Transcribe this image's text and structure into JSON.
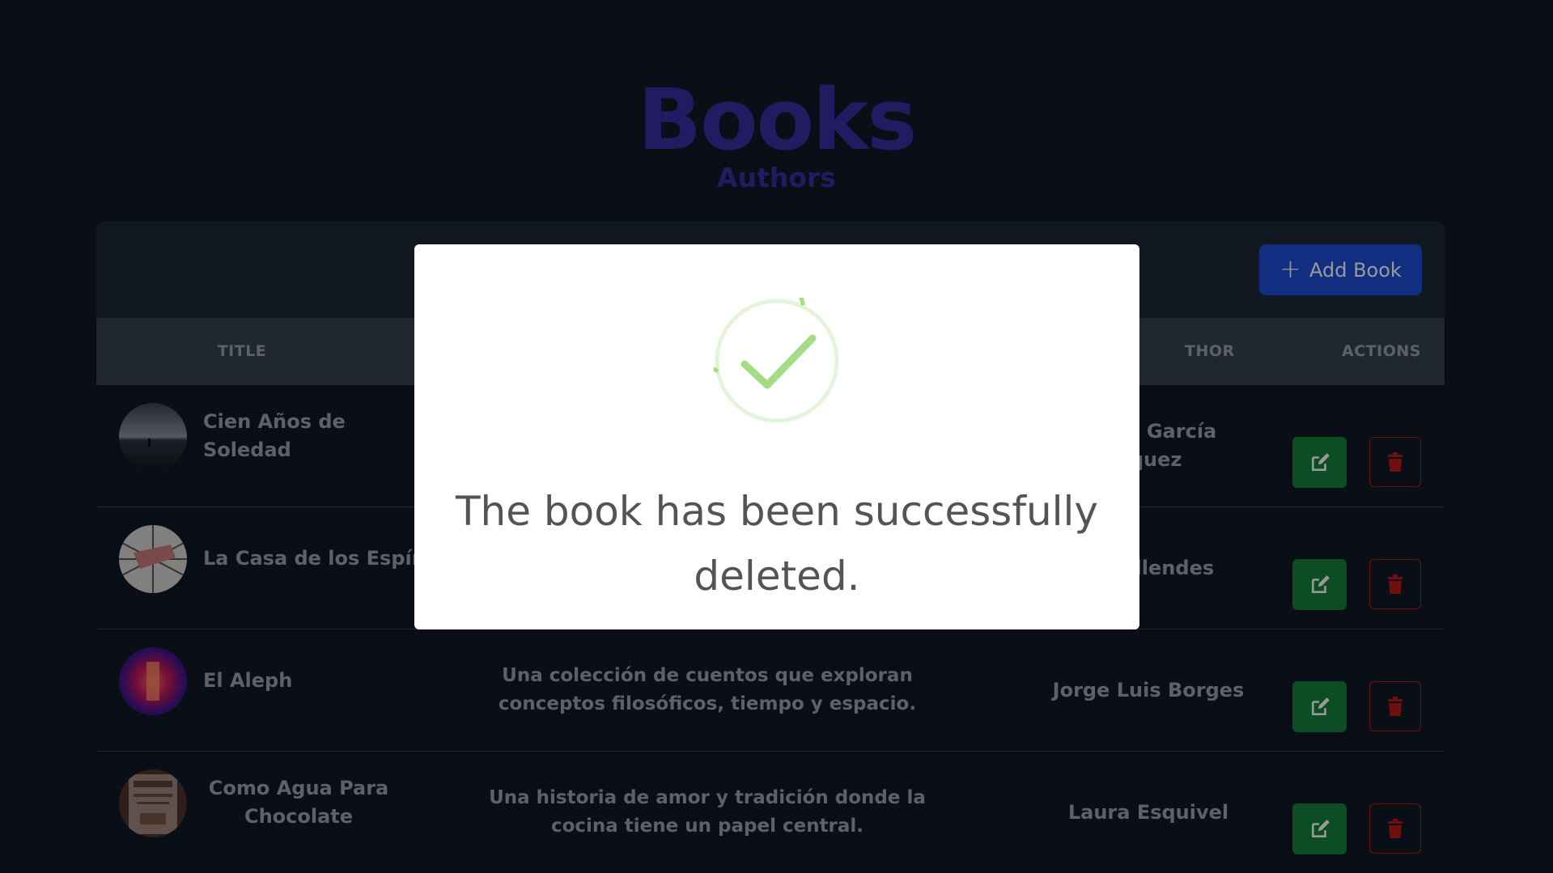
{
  "brand": {
    "title": "Books",
    "subtitle": "Authors"
  },
  "toolbar": {
    "add_label": "Add Book",
    "add_icon": "plus-icon"
  },
  "table": {
    "headers": {
      "title": "TITLE",
      "author": "THOR",
      "actions": "ACTIONS"
    },
    "rows": [
      {
        "title": "Cien Años de Soledad",
        "description": "",
        "author": "el García\nrquez"
      },
      {
        "title": "La Casa de los Espíritus",
        "description": "",
        "author": "Allendes"
      },
      {
        "title": "El Aleph",
        "description": "Una colección de cuentos que exploran conceptos filosóficos, tiempo y espacio.",
        "author": "Jorge Luis Borges"
      },
      {
        "title": "Como Agua Para Chocolate",
        "description": "Una historia de amor y tradición donde la cocina tiene un papel central.",
        "author": "Laura Esquivel"
      }
    ]
  },
  "modal": {
    "icon": "success-check-icon",
    "message": "The book has been successfully deleted."
  },
  "colors": {
    "background": "#111827",
    "brand": "#3730a3",
    "add_button": "#1d4ed8",
    "edit_button": "#15803d",
    "delete_border": "#b91c1c",
    "success": "#a5dc86"
  }
}
